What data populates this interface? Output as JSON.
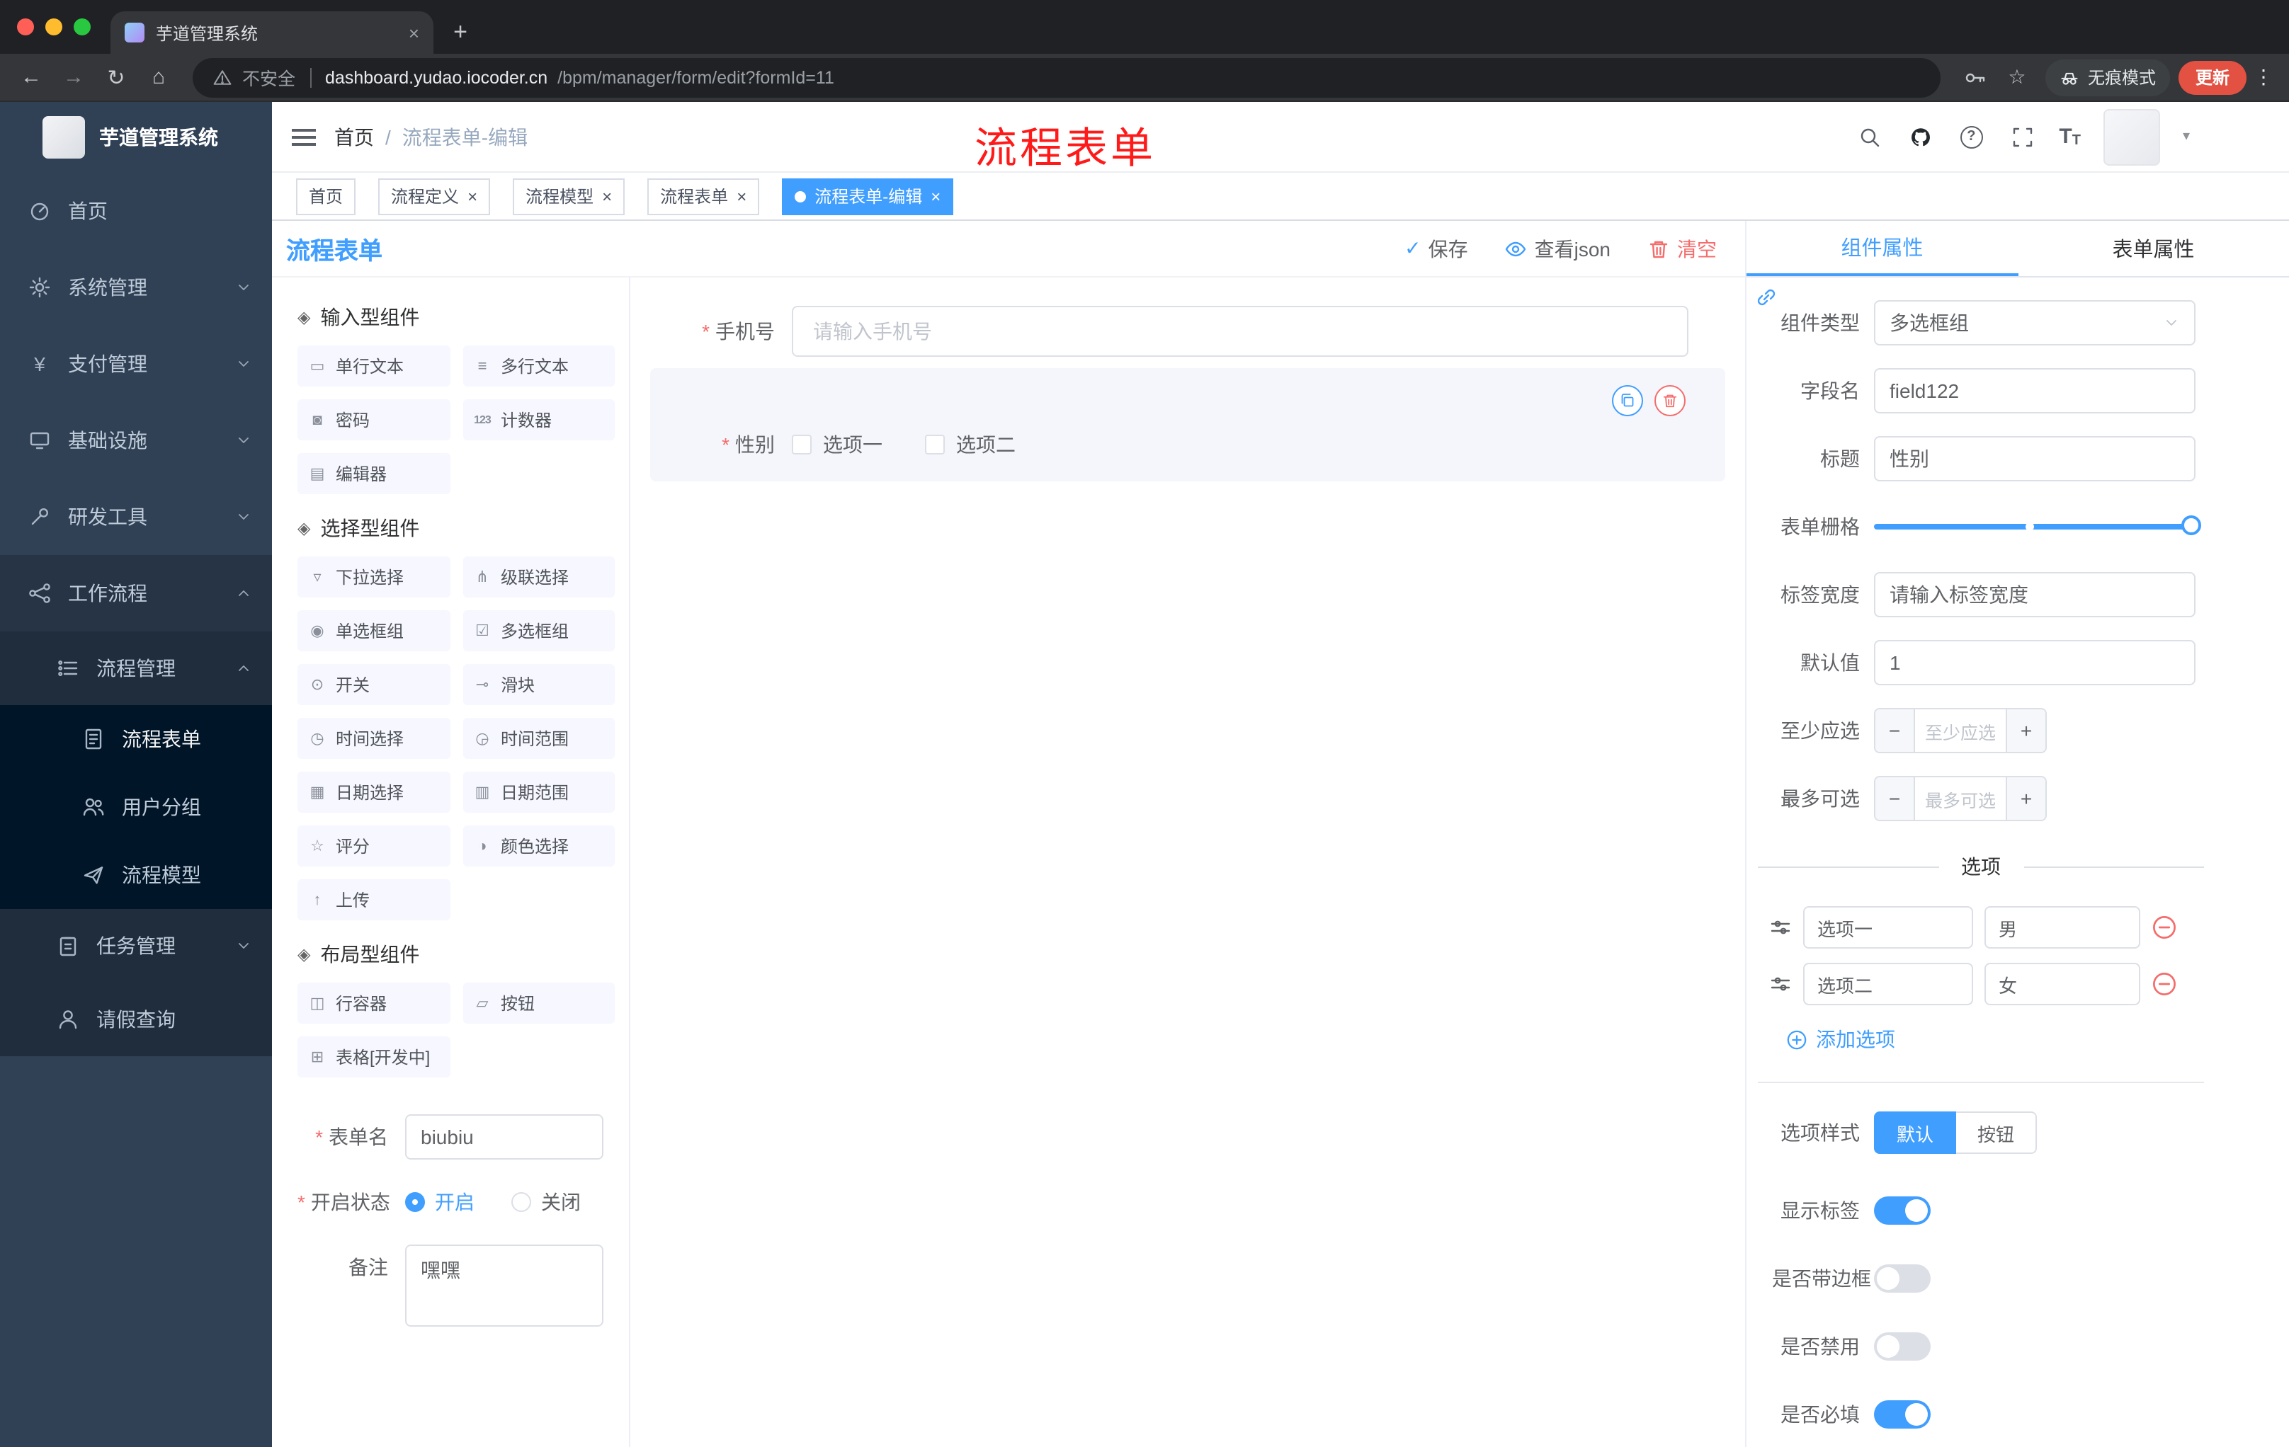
{
  "browser": {
    "tab_title": "芋道管理系统",
    "url_security": "不安全",
    "url_host": "dashboard.yudao.iocoder.cn",
    "url_path": "/bpm/manager/form/edit?formId=11",
    "incognito_label": "无痕模式",
    "update_label": "更新"
  },
  "sidebar": {
    "logo_title": "芋道管理系统",
    "items": [
      {
        "label": "首页"
      },
      {
        "label": "系统管理"
      },
      {
        "label": "支付管理"
      },
      {
        "label": "基础设施"
      },
      {
        "label": "研发工具"
      },
      {
        "label": "工作流程"
      },
      {
        "label": "流程管理"
      },
      {
        "label": "流程表单"
      },
      {
        "label": "用户分组"
      },
      {
        "label": "流程模型"
      },
      {
        "label": "任务管理"
      },
      {
        "label": "请假查询"
      }
    ]
  },
  "header": {
    "breadcrumb_home": "首页",
    "breadcrumb_sep": "/",
    "breadcrumb_current": "流程表单-编辑",
    "annotation": "流程表单"
  },
  "tags": [
    {
      "label": "首页",
      "closable": false,
      "active": false
    },
    {
      "label": "流程定义",
      "closable": true,
      "active": false
    },
    {
      "label": "流程模型",
      "closable": true,
      "active": false
    },
    {
      "label": "流程表单",
      "closable": true,
      "active": false
    },
    {
      "label": "流程表单-编辑",
      "closable": true,
      "active": true
    }
  ],
  "designer": {
    "title": "流程表单",
    "save_label": "保存",
    "view_json_label": "查看json",
    "clear_label": "清空",
    "groups": [
      {
        "title": "输入型组件",
        "items": [
          "单行文本",
          "多行文本",
          "密码",
          "计数器",
          "编辑器"
        ]
      },
      {
        "title": "选择型组件",
        "items": [
          "下拉选择",
          "级联选择",
          "单选框组",
          "多选框组",
          "开关",
          "滑块",
          "时间选择",
          "时间范围",
          "日期选择",
          "日期范围",
          "评分",
          "颜色选择",
          "上传"
        ]
      },
      {
        "title": "布局型组件",
        "items": [
          "行容器",
          "按钮",
          "表格[开发中]"
        ]
      }
    ],
    "meta": {
      "form_name_label": "表单名",
      "form_name_value": "biubiu",
      "status_label": "开启状态",
      "status_on": "开启",
      "status_off": "关闭",
      "remark_label": "备注",
      "remark_value": "嘿嘿"
    },
    "canvas": {
      "phone_label": "手机号",
      "phone_placeholder": "请输入手机号",
      "gender_label": "性别",
      "gender_options": [
        "选项一",
        "选项二"
      ]
    }
  },
  "props": {
    "tab_component": "组件属性",
    "tab_form": "表单属性",
    "rows": {
      "type_label": "组件类型",
      "type_value": "多选框组",
      "field_label": "字段名",
      "field_value": "field122",
      "title_label": "标题",
      "title_value": "性别",
      "grid_label": "表单栅格",
      "tagw_label": "标签宽度",
      "tagw_placeholder": "请输入标签宽度",
      "default_label": "默认值",
      "default_value": "1",
      "min_label": "至少应选",
      "min_placeholder": "至少应选",
      "max_label": "最多可选",
      "max_placeholder": "最多可选"
    },
    "options": {
      "divider": "选项",
      "rows": [
        {
          "label": "选项一",
          "value": "男"
        },
        {
          "label": "选项二",
          "value": "女"
        }
      ],
      "add_label": "添加选项"
    },
    "style_label": "选项样式",
    "style_default": "默认",
    "style_button": "按钮",
    "toggles": [
      {
        "label": "显示标签",
        "on": true
      },
      {
        "label": "是否带边框",
        "on": false
      },
      {
        "label": "是否禁用",
        "on": false
      },
      {
        "label": "是否必填",
        "on": true
      }
    ]
  },
  "icons": {
    "back": "←",
    "forward": "→",
    "reload": "↻",
    "home": "⌂",
    "star": "☆",
    "kebab": "⋮",
    "plus": "+",
    "minus": "−",
    "close": "×",
    "caret_down": "▾",
    "check": "✓",
    "question": "?",
    "yen": "¥",
    "font_big": "T",
    "font_small": "T",
    "group_marker": "◈",
    "chip_input_text": "▭",
    "chip_textarea": "≡",
    "chip_password": "◙",
    "chip_counter": "123",
    "chip_editor": "▤",
    "chip_select": "▿",
    "chip_cascader": "⋔",
    "chip_radio": "◉",
    "chip_checkbox": "☑",
    "chip_switch": "⊙",
    "chip_slider": "⊸",
    "chip_time": "◷",
    "chip_time_range": "◶",
    "chip_date": "▦",
    "chip_date_range": "▥",
    "chip_rate": "☆",
    "chip_color": "◑",
    "chip_upload": "↑",
    "chip_row": "◫",
    "chip_button": "▱",
    "chip_table": "⊞"
  },
  "colors": {
    "accent": "#409eff",
    "danger": "#f56c6c",
    "sidebar_bg": "#304156",
    "sidebar_sub_bg": "#1f2d3d",
    "sidebar_deep_bg": "#001528",
    "tag_active": "#409eff",
    "annotation_red": "#ff1a1a"
  }
}
